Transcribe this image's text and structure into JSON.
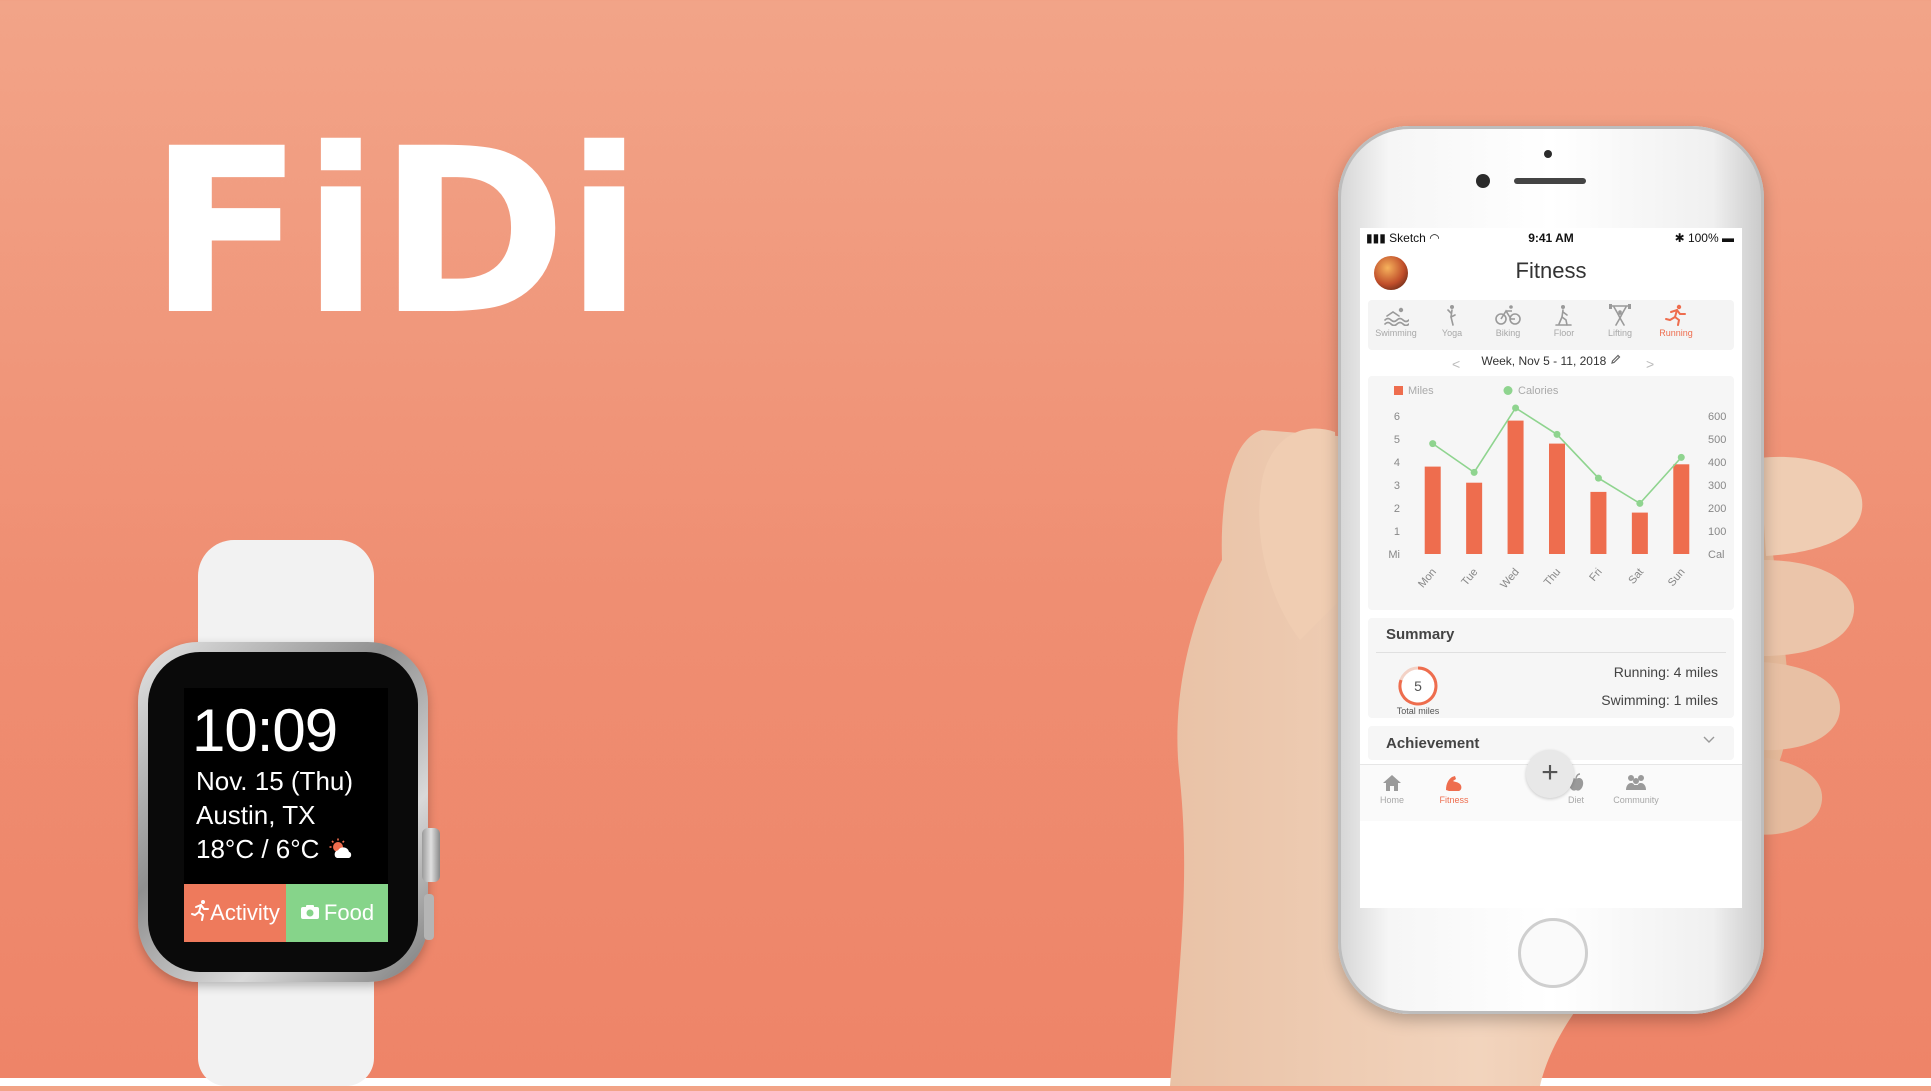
{
  "brand": {
    "title": "FiDi"
  },
  "watch": {
    "time": "10:09",
    "date": "Nov. 15 (Thu)",
    "city": "Austin, TX",
    "temperature": "18°C / 6°C",
    "weather_icon": "sun-cloud-icon",
    "activity_label": "Activity",
    "food_label": "Food",
    "colors": {
      "activity": "#ee7a5c",
      "food": "#86d48a"
    }
  },
  "phone": {
    "status": {
      "carrier": "Sketch",
      "time": "9:41 AM",
      "battery": "100%"
    },
    "title": "Fitness",
    "activities": [
      {
        "label": "Swimming",
        "icon": "swimming-icon",
        "active": false
      },
      {
        "label": "Yoga",
        "icon": "yoga-icon",
        "active": false
      },
      {
        "label": "Biking",
        "icon": "biking-icon",
        "active": false
      },
      {
        "label": "Floor",
        "icon": "floor-icon",
        "active": false
      },
      {
        "label": "Lifting",
        "icon": "lifting-icon",
        "active": false
      },
      {
        "label": "Running",
        "icon": "running-icon",
        "active": true
      }
    ],
    "week": {
      "label": "Week, Nov 5 - 11, 2018",
      "prev": "<",
      "next": ">"
    },
    "summary": {
      "title": "Summary",
      "total_value": "5",
      "total_label": "Total miles",
      "running": "Running: 4 miles",
      "swimming": "Swimming: 1 miles"
    },
    "achievement": {
      "title": "Achievement"
    },
    "add_label": "+",
    "tabs": [
      {
        "label": "Home",
        "icon": "home-icon",
        "active": false
      },
      {
        "label": "Fitness",
        "icon": "fitness-icon",
        "active": true
      },
      {
        "label": "Diet",
        "icon": "diet-icon",
        "active": false
      },
      {
        "label": "Community",
        "icon": "community-icon",
        "active": false
      }
    ],
    "colors": {
      "accent": "#ee6d4e",
      "calories": "#8fd48f"
    }
  },
  "chart_data": {
    "type": "bar",
    "categories": [
      "Mon",
      "Tue",
      "Wed",
      "Thu",
      "Fri",
      "Sat",
      "Sun"
    ],
    "series": [
      {
        "name": "Miles",
        "kind": "bar",
        "axis": "left",
        "values": [
          3.8,
          3.1,
          5.8,
          4.8,
          2.7,
          1.8,
          3.9
        ],
        "color": "#ee6d4e"
      },
      {
        "name": "Calories",
        "kind": "line",
        "axis": "right",
        "values": [
          480,
          355,
          635,
          520,
          330,
          220,
          420
        ],
        "color": "#8fd48f"
      }
    ],
    "left_axis": {
      "unit": "Mi",
      "ticks": [
        "1",
        "2",
        "3",
        "4",
        "5",
        "6"
      ],
      "range": [
        0,
        6
      ]
    },
    "right_axis": {
      "unit": "Cal",
      "ticks": [
        "100",
        "200",
        "300",
        "400",
        "500",
        "600"
      ],
      "range": [
        0,
        600
      ]
    },
    "legend_position": "top-left",
    "grid": false
  }
}
